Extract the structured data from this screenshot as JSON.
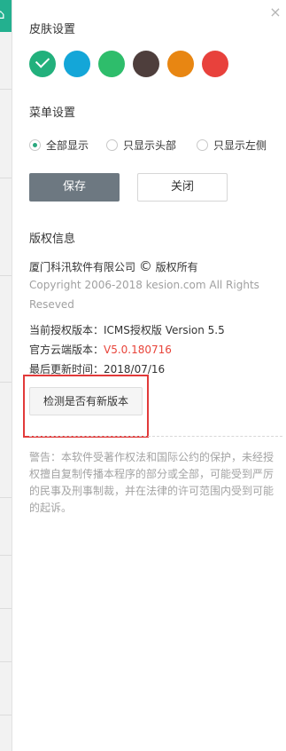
{
  "close_symbol": "×",
  "skin": {
    "title": "皮肤设置",
    "swatches": [
      {
        "color": "#22b07c",
        "selected": true
      },
      {
        "color": "#14a6d8",
        "selected": false
      },
      {
        "color": "#2ebd6b",
        "selected": false
      },
      {
        "color": "#4e3e3c",
        "selected": false
      },
      {
        "color": "#e88612",
        "selected": false
      },
      {
        "color": "#e8413c",
        "selected": false
      }
    ]
  },
  "menu": {
    "title": "菜单设置",
    "options": [
      {
        "label": "全部显示",
        "selected": true
      },
      {
        "label": "只显示头部",
        "selected": false
      },
      {
        "label": "只显示左侧",
        "selected": false
      }
    ]
  },
  "buttons": {
    "save": "保存",
    "close": "关闭"
  },
  "copyright": {
    "title": "版权信息",
    "company": "厦门科汛软件有限公司",
    "rights": "版权所有",
    "copyright_line1": "Copyright 2006-2018 kesion.com All Rights",
    "copyright_line2": "Reseved",
    "license_label": "当前授权版本：",
    "license_value": "ICMS授权版 Version 5.5",
    "cloud_label": "官方云端版本：",
    "cloud_value": "V5.0.180716",
    "updated_label": "最后更新时间：",
    "updated_value": "2018/07/16",
    "check_button": "检测是否有新版本"
  },
  "warning": "警告：本软件受著作权法和国际公约的保护，未经授权擅自复制传播本程序的部分或全部，可能受到严厉的民事及刑事制裁，并在法律的许可范围内受到可能的起诉。",
  "colors": {
    "accent": "#2aa87e",
    "save_button": "#6d7881",
    "highlight": "#e23a3a",
    "version_red": "#e8443a"
  }
}
